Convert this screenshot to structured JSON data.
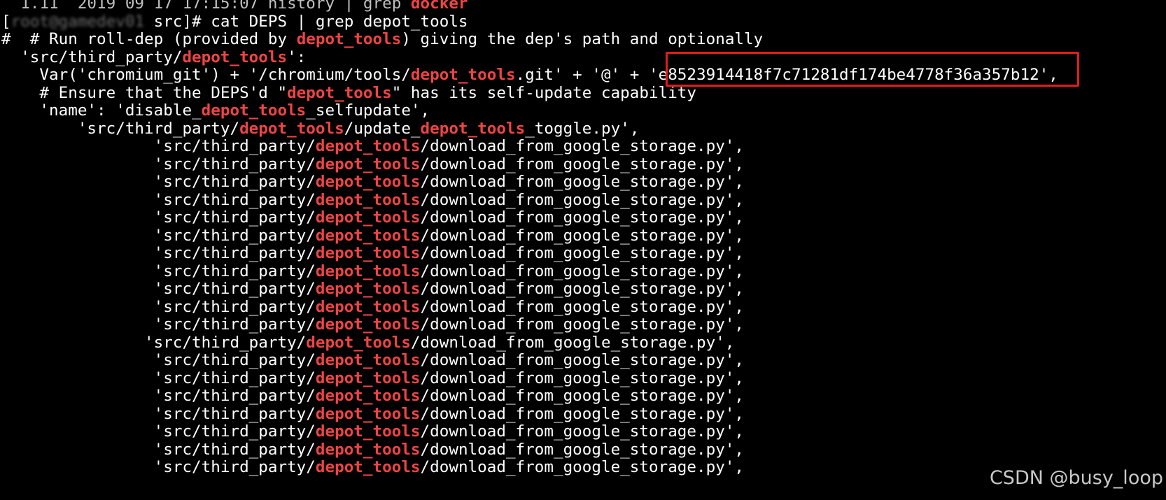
{
  "terminal": {
    "colors": {
      "background": "#000000",
      "text": "#ffffff",
      "highlight": "#ef4444",
      "callout": "#e11d1d"
    },
    "lines": [
      {
        "segments": [
          {
            "t": "  1.11  2019 09 17 17:15:07 history | grep ",
            "k": "dim"
          },
          {
            "t": "docker",
            "k": "hl"
          }
        ]
      },
      {
        "segments": [
          {
            "t": "[",
            "k": "n"
          },
          {
            "t": "root@gamedev01",
            "k": "blur"
          },
          {
            "t": " src]# cat DEPS | grep depot_tools",
            "k": "n"
          }
        ]
      },
      {
        "segments": [
          {
            "t": "#  # Run roll-dep (provided by ",
            "k": "n"
          },
          {
            "t": "depot_tools",
            "k": "hl"
          },
          {
            "t": ") giving the dep's path and optionally",
            "k": "n"
          }
        ]
      },
      {
        "segments": [
          {
            "t": "  'src/third_party/",
            "k": "n"
          },
          {
            "t": "depot_tools",
            "k": "hl"
          },
          {
            "t": "':",
            "k": "n"
          }
        ]
      },
      {
        "segments": [
          {
            "t": "    Var('chromium_git') + '/chromium/tools/",
            "k": "n"
          },
          {
            "t": "depot_tools",
            "k": "hl"
          },
          {
            "t": ".git' + '@' + 'e8523914418f7c71281df174be4778f36a357b12',",
            "k": "n"
          }
        ]
      },
      {
        "segments": [
          {
            "t": "    # Ensure that the DEPS'd \"",
            "k": "n"
          },
          {
            "t": "depot_tools",
            "k": "hl"
          },
          {
            "t": "\" has its self-update capability",
            "k": "n"
          }
        ]
      },
      {
        "segments": [
          {
            "t": "    'name': 'disable_",
            "k": "n"
          },
          {
            "t": "depot_tools",
            "k": "hl"
          },
          {
            "t": "_selfupdate',",
            "k": "n"
          }
        ]
      },
      {
        "segments": [
          {
            "t": "        'src/third_party/",
            "k": "n"
          },
          {
            "t": "depot_tools",
            "k": "hl"
          },
          {
            "t": "/update_",
            "k": "n"
          },
          {
            "t": "depot_tools",
            "k": "hl"
          },
          {
            "t": "_toggle.py',",
            "k": "n"
          }
        ]
      },
      {
        "segments": [
          {
            "t": "                'src/third_party/",
            "k": "n"
          },
          {
            "t": "depot_tools",
            "k": "hl"
          },
          {
            "t": "/download_from_google_storage.py',",
            "k": "n"
          }
        ]
      },
      {
        "segments": [
          {
            "t": "                'src/third_party/",
            "k": "n"
          },
          {
            "t": "depot_tools",
            "k": "hl"
          },
          {
            "t": "/download_from_google_storage.py',",
            "k": "n"
          }
        ]
      },
      {
        "segments": [
          {
            "t": "                'src/third_party/",
            "k": "n"
          },
          {
            "t": "depot_tools",
            "k": "hl"
          },
          {
            "t": "/download_from_google_storage.py',",
            "k": "n"
          }
        ]
      },
      {
        "segments": [
          {
            "t": "                'src/third_party/",
            "k": "n"
          },
          {
            "t": "depot_tools",
            "k": "hl"
          },
          {
            "t": "/download_from_google_storage.py',",
            "k": "n"
          }
        ]
      },
      {
        "segments": [
          {
            "t": "                'src/third_party/",
            "k": "n"
          },
          {
            "t": "depot_tools",
            "k": "hl"
          },
          {
            "t": "/download_from_google_storage.py',",
            "k": "n"
          }
        ]
      },
      {
        "segments": [
          {
            "t": "                'src/third_party/",
            "k": "n"
          },
          {
            "t": "depot_tools",
            "k": "hl"
          },
          {
            "t": "/download_from_google_storage.py',",
            "k": "n"
          }
        ]
      },
      {
        "segments": [
          {
            "t": "                'src/third_party/",
            "k": "n"
          },
          {
            "t": "depot_tools",
            "k": "hl"
          },
          {
            "t": "/download_from_google_storage.py',",
            "k": "n"
          }
        ]
      },
      {
        "segments": [
          {
            "t": "                'src/third_party/",
            "k": "n"
          },
          {
            "t": "depot_tools",
            "k": "hl"
          },
          {
            "t": "/download_from_google_storage.py',",
            "k": "n"
          }
        ]
      },
      {
        "segments": [
          {
            "t": "                'src/third_party/",
            "k": "n"
          },
          {
            "t": "depot_tools",
            "k": "hl"
          },
          {
            "t": "/download_from_google_storage.py',",
            "k": "n"
          }
        ]
      },
      {
        "segments": [
          {
            "t": "                'src/third_party/",
            "k": "n"
          },
          {
            "t": "depot_tools",
            "k": "hl"
          },
          {
            "t": "/download_from_google_storage.py',",
            "k": "n"
          }
        ]
      },
      {
        "segments": [
          {
            "t": "                'src/third_party/",
            "k": "n"
          },
          {
            "t": "depot_tools",
            "k": "hl"
          },
          {
            "t": "/download_from_google_storage.py',",
            "k": "n"
          }
        ]
      },
      {
        "segments": [
          {
            "t": "               'src/third_party/",
            "k": "n"
          },
          {
            "t": "depot_tools",
            "k": "hl"
          },
          {
            "t": "/download_from_google_storage.py',",
            "k": "n"
          }
        ]
      },
      {
        "segments": [
          {
            "t": "                'src/third_party/",
            "k": "n"
          },
          {
            "t": "depot_tools",
            "k": "hl"
          },
          {
            "t": "/download_from_google_storage.py',",
            "k": "n"
          }
        ]
      },
      {
        "segments": [
          {
            "t": "                'src/third_party/",
            "k": "n"
          },
          {
            "t": "depot_tools",
            "k": "hl"
          },
          {
            "t": "/download_from_google_storage.py',",
            "k": "n"
          }
        ]
      },
      {
        "segments": [
          {
            "t": "                'src/third_party/",
            "k": "n"
          },
          {
            "t": "depot_tools",
            "k": "hl"
          },
          {
            "t": "/download_from_google_storage.py',",
            "k": "n"
          }
        ]
      },
      {
        "segments": [
          {
            "t": "                'src/third_party/",
            "k": "n"
          },
          {
            "t": "depot_tools",
            "k": "hl"
          },
          {
            "t": "/download_from_google_storage.py',",
            "k": "n"
          }
        ]
      },
      {
        "segments": [
          {
            "t": "                'src/third_party/",
            "k": "n"
          },
          {
            "t": "depot_tools",
            "k": "hl"
          },
          {
            "t": "/download_from_google_storage.py',",
            "k": "n"
          }
        ]
      },
      {
        "segments": [
          {
            "t": "                'src/third_party/",
            "k": "n"
          },
          {
            "t": "depot_tools",
            "k": "hl"
          },
          {
            "t": "/download_from_google_storage.py',",
            "k": "n"
          }
        ]
      },
      {
        "segments": [
          {
            "t": "                'src/third_party/",
            "k": "n"
          },
          {
            "t": "depot_tools",
            "k": "hl"
          },
          {
            "t": "/download_from_google_storage.py',",
            "k": "n"
          }
        ]
      }
    ]
  },
  "watermark": {
    "text": "CSDN @busy_loop"
  }
}
